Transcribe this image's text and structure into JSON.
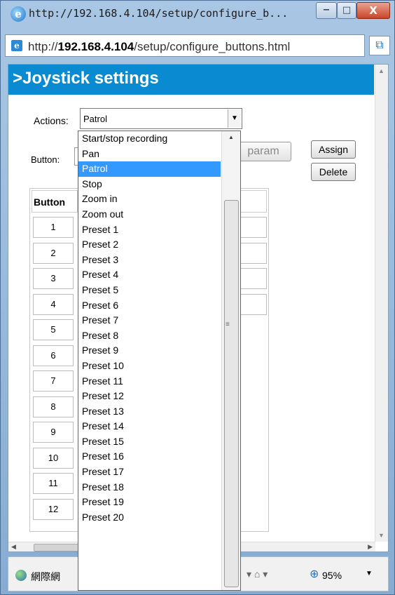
{
  "window": {
    "title": "http://192.168.4.104/setup/configure_b...",
    "min_label": "−",
    "max_label": "□",
    "close_label": "X"
  },
  "address": {
    "url_prefix": "http://",
    "url_host": "192.168.4.104",
    "url_path": "/setup/configure_buttons.html"
  },
  "page": {
    "header": ">Joystick settings",
    "actions_label": "Actions:",
    "actions_value": "Patrol",
    "button_label": "Button:",
    "param_label": "param",
    "assign_label": "Assign",
    "delete_label": "Delete",
    "table_header": "Button",
    "rows": [
      "1",
      "2",
      "3",
      "4",
      "5",
      "6",
      "7",
      "8",
      "9",
      "10",
      "11",
      "12"
    ]
  },
  "dropdown": {
    "items": [
      "Start/stop recording",
      "Pan",
      "Patrol",
      "Stop",
      "Zoom in",
      "Zoom out",
      "Preset 1",
      "Preset 2",
      "Preset 3",
      "Preset 4",
      "Preset 5",
      "Preset 6",
      "Preset 7",
      "Preset 8",
      "Preset 9",
      "Preset 10",
      "Preset 11",
      "Preset 12",
      "Preset 13",
      "Preset 14",
      "Preset 15",
      "Preset 16",
      "Preset 17",
      "Preset 18",
      "Preset 19",
      "Preset 20"
    ],
    "selected": "Patrol"
  },
  "status": {
    "zone": "網際網",
    "zoom": "95%"
  },
  "colors": {
    "header_bg": "#0a8bd1",
    "selection": "#3399ff"
  }
}
